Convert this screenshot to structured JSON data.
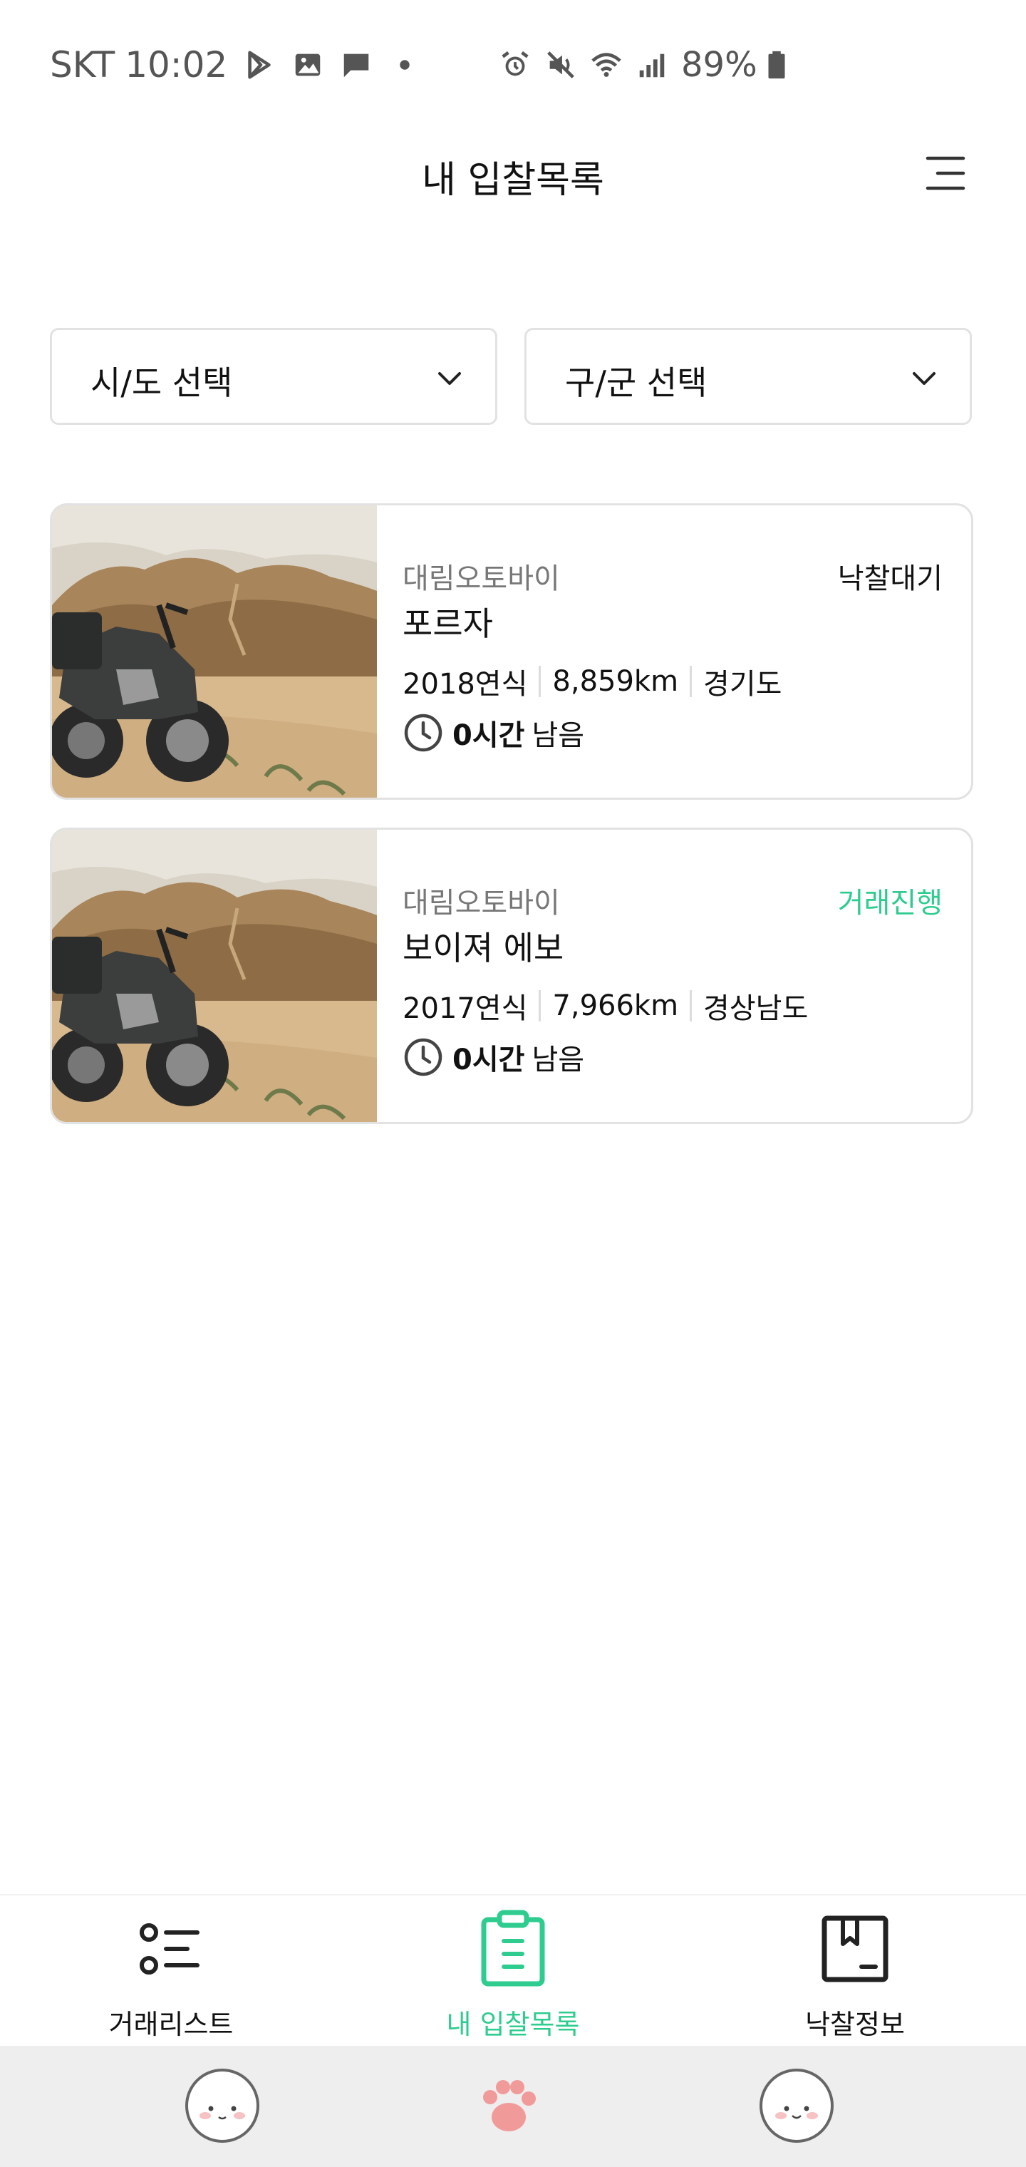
{
  "status_bar": {
    "carrier": "SKT",
    "time": "10:02",
    "battery": "89%",
    "icons": [
      "play-store-icon",
      "gallery-icon",
      "message-icon",
      "dot-icon",
      "alarm-icon",
      "mute-icon",
      "wifi-icon",
      "signal-icon",
      "battery-icon"
    ]
  },
  "header": {
    "title": "내 입찰목록",
    "menu_icon": "hamburger-menu-icon"
  },
  "filters": {
    "city": {
      "label": "시/도 선택"
    },
    "district": {
      "label": "구/군 선택"
    }
  },
  "listings": [
    {
      "dealer": "대림오토바이",
      "status": "낙찰대기",
      "status_color": "#111111",
      "model": "포르자",
      "year": "2018연식",
      "mileage": "8,859km",
      "region": "경기도",
      "time_value": "0시간",
      "time_suffix": "남음"
    },
    {
      "dealer": "대림오토바이",
      "status": "거래진행",
      "status_color": "#2ecc8f",
      "model": "보이져 에보",
      "year": "2017연식",
      "mileage": "7,966km",
      "region": "경상남도",
      "time_value": "0시간",
      "time_suffix": "남음"
    }
  ],
  "bottom_nav": {
    "active_color": "#2ecc8f",
    "items": [
      {
        "label": "거래리스트",
        "icon": "list-icon",
        "active": false
      },
      {
        "label": "내 입찰목록",
        "icon": "clipboard-icon",
        "active": true
      },
      {
        "label": "낙찰정보",
        "icon": "bookmark-icon",
        "active": false
      }
    ]
  },
  "system_nav": {
    "icons": [
      "face-left-icon",
      "paw-icon",
      "face-right-icon"
    ]
  }
}
